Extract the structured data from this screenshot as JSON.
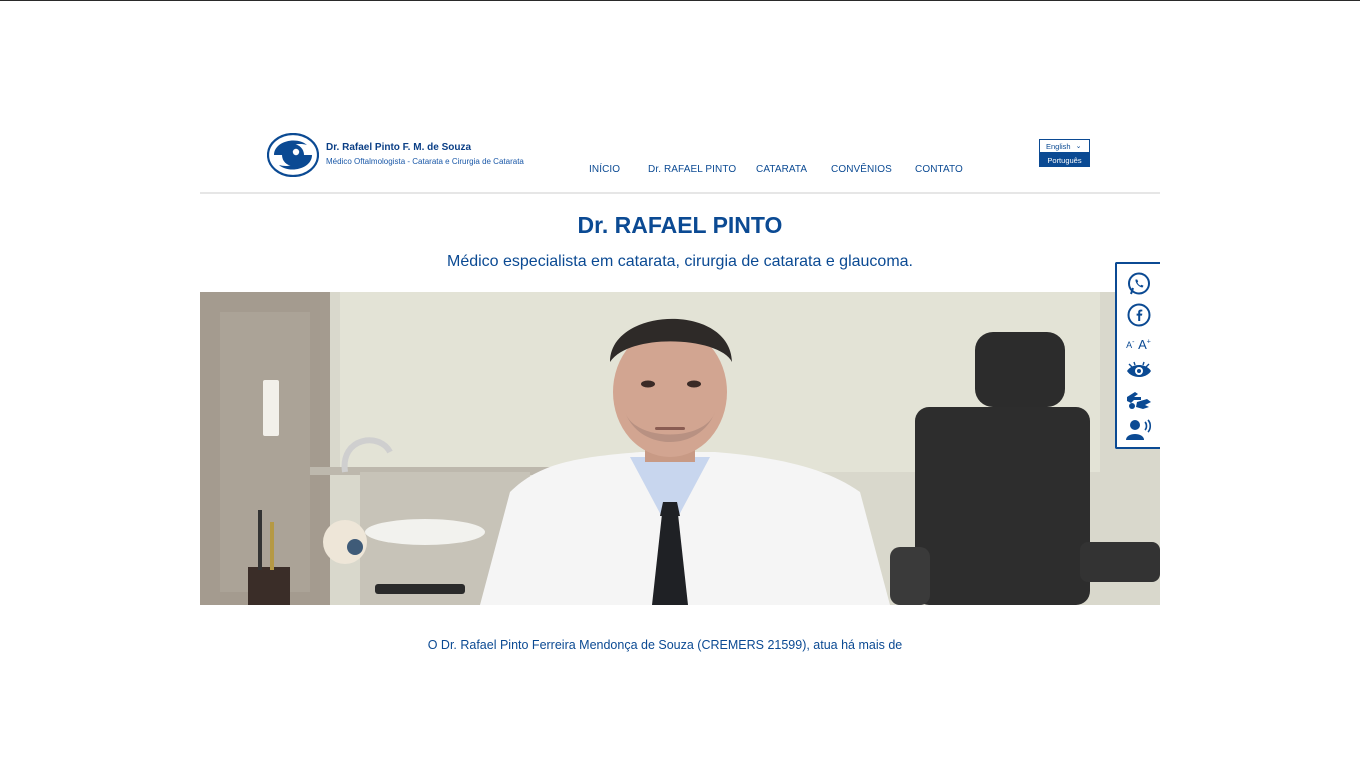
{
  "brand": {
    "name": "Dr. Rafael Pinto F. M. de Souza",
    "tagline": "Médico Oftalmologista - Catarata e Cirurgia de Catarata"
  },
  "nav": {
    "items": [
      {
        "label": "INÍCIO"
      },
      {
        "label": "Dr. RAFAEL PINTO"
      },
      {
        "label": "CATARATA"
      },
      {
        "label": "CONVÊNIOS"
      },
      {
        "label": "CONTATO"
      }
    ]
  },
  "language": {
    "selected": "English",
    "option": "Português"
  },
  "hero": {
    "title": "Dr. RAFAEL PINTO",
    "subtitle": "Médico especialista em catarata, cirurgia de catarata e glaucoma."
  },
  "accessibility": {
    "font_decrease": "A",
    "font_increase": "A",
    "icons": [
      "whatsapp-icon",
      "facebook-icon",
      "font-size-icon",
      "contrast-eye-icon",
      "sign-language-icon",
      "screen-reader-icon"
    ]
  },
  "intro": {
    "text": "O Dr. Rafael Pinto Ferreira Mendonça de Souza (CREMERS 21599), atua há mais de"
  },
  "colors": {
    "brand_blue": "#0b4a93",
    "header_rule": "#e6e6e6"
  }
}
